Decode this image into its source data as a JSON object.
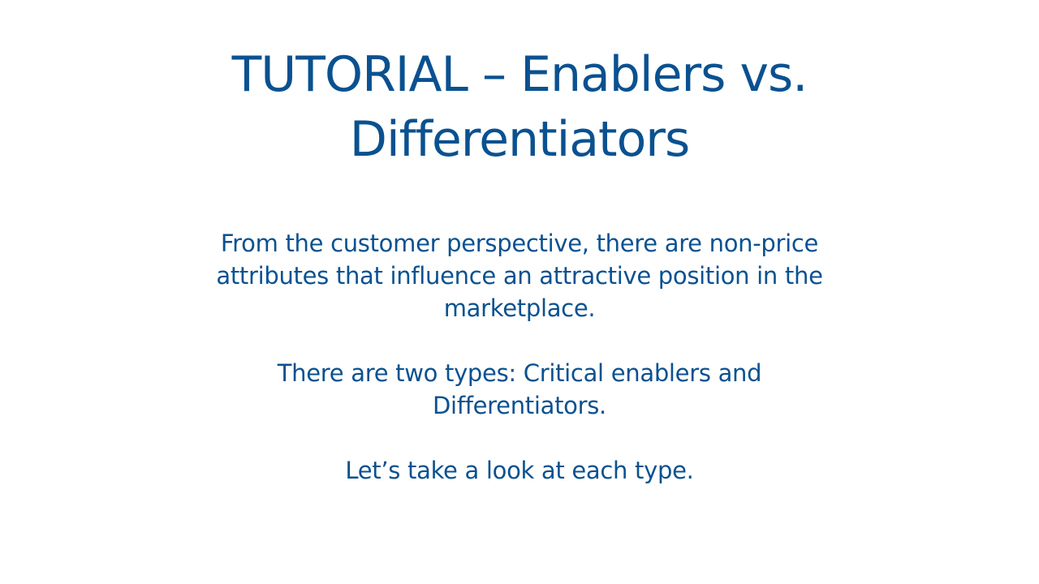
{
  "slide": {
    "title_lines": [
      "TUTORIAL – Enablers vs.",
      "Differentiators"
    ],
    "paragraphs": [
      {
        "lines": [
          "From the customer perspective, there are non-price",
          "attributes that influence an attractive position in the",
          "marketplace."
        ]
      },
      {
        "lines": [
          "There are two types: Critical enablers and",
          "Differentiators."
        ]
      },
      {
        "lines": [
          "Let’s take a look at each type."
        ]
      }
    ]
  },
  "colors": {
    "text": "#0a5190",
    "background": "#ffffff"
  }
}
